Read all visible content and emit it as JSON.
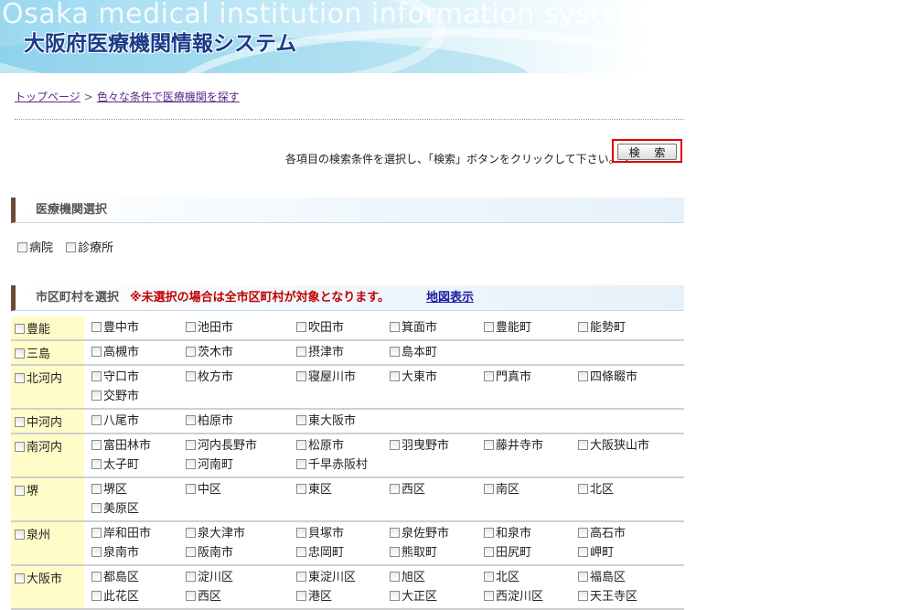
{
  "header": {
    "title_en": "Osaka medical institution information system",
    "title_jp": "大阪府医療機関情報システム"
  },
  "breadcrumb": {
    "home": "トップページ",
    "separator": ">",
    "current": "色々な条件で医療機関を探す"
  },
  "instruction": "各項目の検索条件を選択し、「検索」ボタンをクリックして下さい。→",
  "search_button": "検 索",
  "facility_section": {
    "title": "医療機関選択",
    "options": [
      "病院",
      "診療所"
    ]
  },
  "municipality_section": {
    "title": "市区町村を選択",
    "note": "※未選択の場合は全市区町村が対象となります。",
    "map_link": "地図表示"
  },
  "regions": [
    {
      "name": "豊能",
      "items": [
        "豊中市",
        "池田市",
        "吹田市",
        "箕面市",
        "豊能町",
        "能勢町"
      ]
    },
    {
      "name": "三島",
      "items": [
        "高槻市",
        "茨木市",
        "摂津市",
        "島本町"
      ]
    },
    {
      "name": "北河内",
      "items": [
        "守口市",
        "枚方市",
        "寝屋川市",
        "大東市",
        "門真市",
        "四條畷市",
        "交野市"
      ]
    },
    {
      "name": "中河内",
      "items": [
        "八尾市",
        "柏原市",
        "東大阪市"
      ]
    },
    {
      "name": "南河内",
      "items": [
        "富田林市",
        "河内長野市",
        "松原市",
        "羽曳野市",
        "藤井寺市",
        "大阪狭山市",
        "太子町",
        "河南町",
        "千早赤阪村"
      ]
    },
    {
      "name": "堺",
      "items": [
        "堺区",
        "中区",
        "東区",
        "西区",
        "南区",
        "北区",
        "美原区"
      ]
    },
    {
      "name": "泉州",
      "items": [
        "岸和田市",
        "泉大津市",
        "貝塚市",
        "泉佐野市",
        "和泉市",
        "高石市",
        "泉南市",
        "阪南市",
        "忠岡町",
        "熊取町",
        "田尻町",
        "岬町"
      ]
    },
    {
      "name": "大阪市",
      "items": [
        "都島区",
        "淀川区",
        "東淀川区",
        "旭区",
        "北区",
        "福島区",
        "此花区",
        "西区",
        "港区",
        "大正区",
        "西淀川区",
        "天王寺区"
      ]
    }
  ]
}
